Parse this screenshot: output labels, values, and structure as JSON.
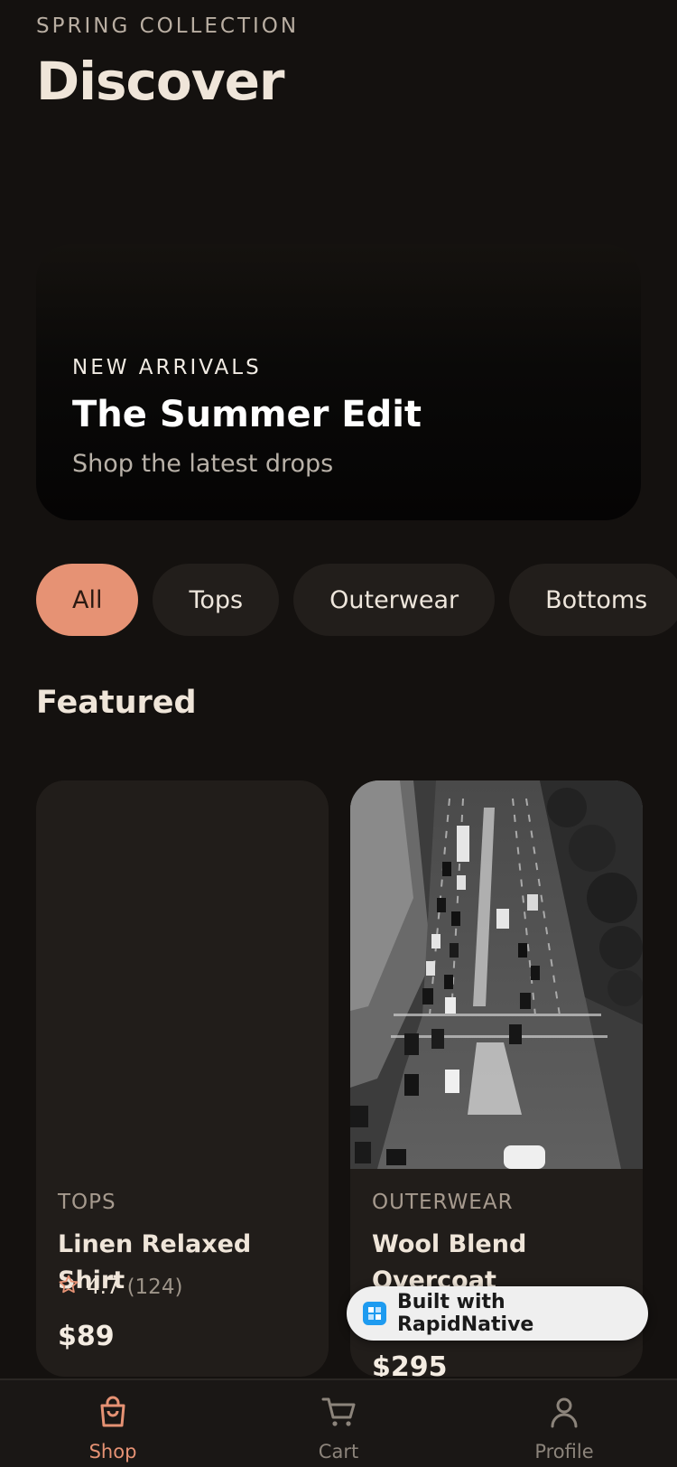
{
  "header": {
    "eyebrow": "SPRING COLLECTION",
    "title": "Discover"
  },
  "hero": {
    "eyebrow": "NEW ARRIVALS",
    "title": "The Summer Edit",
    "subtitle": "Shop the latest drops"
  },
  "categories": {
    "selected": "All",
    "items": [
      "All",
      "Tops",
      "Outerwear",
      "Bottoms"
    ]
  },
  "featured": {
    "title": "Featured",
    "products": [
      {
        "category": "TOPS",
        "name": "Linen Relaxed Shirt",
        "rating": "4.7",
        "review_count": "(124)",
        "price": "$89",
        "image": "empty placeholder"
      },
      {
        "category": "OUTERWEAR",
        "name": "Wool Blend Overcoat",
        "price": "$295",
        "image": "aerial-street-photo"
      }
    ]
  },
  "badge": {
    "label": "Built with RapidNative",
    "icon": "rapidnative-logo-icon"
  },
  "tabbar": {
    "items": [
      {
        "label": "Shop",
        "icon": "shopping-bag-icon",
        "active": true
      },
      {
        "label": "Cart",
        "icon": "cart-icon",
        "active": false
      },
      {
        "label": "Profile",
        "icon": "user-icon",
        "active": false
      }
    ]
  },
  "colors": {
    "background": "#14110f",
    "accent": "#e69274",
    "card": "#211d1a",
    "text_primary": "#efe5d9",
    "text_muted": "#a69a8e"
  }
}
